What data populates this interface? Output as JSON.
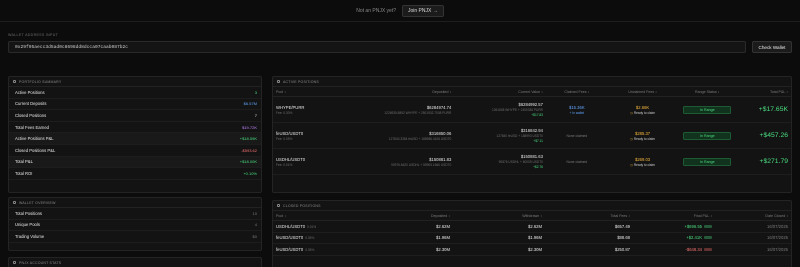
{
  "colors": {
    "green": "#4ade80",
    "blue": "#60a5fa",
    "yellow": "#f5b83d",
    "red": "#f87171",
    "purple": "#c084fc"
  },
  "topbar": {
    "question": "Not an PNJX yet?",
    "join_label": "Join PNJX →"
  },
  "wallet": {
    "label": "WALLET ADDRESS INPUT",
    "address": "0x29f95aecc3d5ad0c8698dd8dcca07caab087b2c",
    "check_label": "Check Wallet"
  },
  "portfolio": {
    "title": "PORTFOLIO SUMMARY",
    "rows": [
      {
        "label": "Active Positions",
        "value": "3",
        "color": "#4ade80",
        "hl": false
      },
      {
        "label": "Current Deposits",
        "value": "$6.57M",
        "color": "#60a5fa",
        "hl": false
      },
      {
        "label": "Closed Positions",
        "value": "7",
        "color": "#e6e6e6",
        "hl": false
      },
      {
        "label": "Total Fees Earned",
        "value": "$19.72K",
        "color": "#c084fc",
        "hl": false
      },
      {
        "label": "Active Positions P&L",
        "value": "+$18.59K",
        "color": "#4ade80",
        "hl": true
      },
      {
        "label": "Closed Positions P&L",
        "value": "-$593.62",
        "color": "#f87171",
        "hl": false
      },
      {
        "label": "Total P&L",
        "value": "+$18.00K",
        "color": "#4ade80",
        "hl": true
      },
      {
        "label": "Total ROI",
        "value": "+0.10%",
        "color": "#4ade80",
        "hl": false
      }
    ]
  },
  "wallet_overview": {
    "title": "WALLET OVERVIEW",
    "rows": [
      {
        "label": "Total Positions",
        "value": "10"
      },
      {
        "label": "Unique Pools",
        "value": "4"
      },
      {
        "label": "Trading Volume",
        "value": "$0"
      }
    ]
  },
  "bottom_left_title": "PNJX ACCOUNT STATS",
  "active": {
    "title": "ACTIVE POSITIONS",
    "headers": [
      "Pool ↕",
      "Deposited ↕",
      "Current Value ↕",
      "Claimed Fees ↕",
      "Unclaimed Fees ↕",
      "Range Status ↕",
      "Total P&L ↕"
    ],
    "rows": [
      {
        "pool": "WHYPE/PURR",
        "fee": "Fee: 0.30%",
        "deposited": "$6284974.74",
        "deposited_sub": "1226935.8892 WHYPE + 2501932.7008 PURR",
        "current": "$6284992.57",
        "current_sub": "1261808 WHYPE + 2450336 PURR",
        "current_delta": "+$17.83",
        "claimed": "$15.36K",
        "claimed_sub": "+ In wallet",
        "claimed_color": "#60a5fa",
        "unclaimed": "$2.66K",
        "unclaimed_sub": "Ready to claim",
        "status": "In Range",
        "pnl": "+$17.65K"
      },
      {
        "pool": "feUSD/USDT0",
        "fee": "Fee: 0.05%",
        "deposited": "$316850.06",
        "deposited_sub": "127840.3354 feUSD + 188986.4106 USDT0",
        "current": "$316842.94",
        "current_sub": "127840 feUSD + 188993 USDT0",
        "current_delta": "+$7.11",
        "claimed": "None claimed",
        "claimed_sub": "",
        "claimed_color": "#7a7a7a",
        "unclaimed": "$285.37",
        "unclaimed_sub": "Ready to claim",
        "status": "In Range",
        "pnl": "+$457.26"
      },
      {
        "pool": "USDHL/USDT0",
        "fee": "Fee: 0.01%",
        "deposited": "$150881.83",
        "deposited_sub": "90976.6620 USDHL + 59905.1666 USDT0",
        "current": "$150881.63",
        "current_sub": "90876 USDHL + 60005 USDT0",
        "current_delta": "+$2.76",
        "claimed": "None claimed",
        "claimed_sub": "",
        "claimed_color": "#7a7a7a",
        "unclaimed": "$269.03",
        "unclaimed_sub": "Ready to claim",
        "status": "In Range",
        "pnl": "+$271.79"
      }
    ]
  },
  "closed": {
    "title": "CLOSED POSITIONS",
    "headers": [
      "Pool ↕",
      "Deposited ↕",
      "Withdrawn ↕",
      "Total Fees ↕",
      "Final P&L ↕",
      "Date Closed ↕"
    ],
    "rows": [
      {
        "pool": "USDHL/USDT0",
        "fee": "0.01%",
        "deposited": "$2.62M",
        "withdrawn": "$2.62M",
        "fees": "$657.49",
        "pnl": "+$696.55",
        "pnl_color": "#4ade80",
        "date": "16/07/2025"
      },
      {
        "pool": "feUSD/USDT0",
        "fee": "0.05%",
        "deposited": "$1.96M",
        "withdrawn": "$1.96M",
        "fees": "$88.68",
        "pnl": "+$2.41K",
        "pnl_color": "#4ade80",
        "date": "16/07/2025"
      },
      {
        "pool": "feUSD/USDT0",
        "fee": "0.05%",
        "deposited": "$2.30M",
        "withdrawn": "$2.30M",
        "fees": "$250.87",
        "pnl": "-$648.34",
        "pnl_color": "#f87171",
        "date": "16/07/2025"
      }
    ]
  }
}
